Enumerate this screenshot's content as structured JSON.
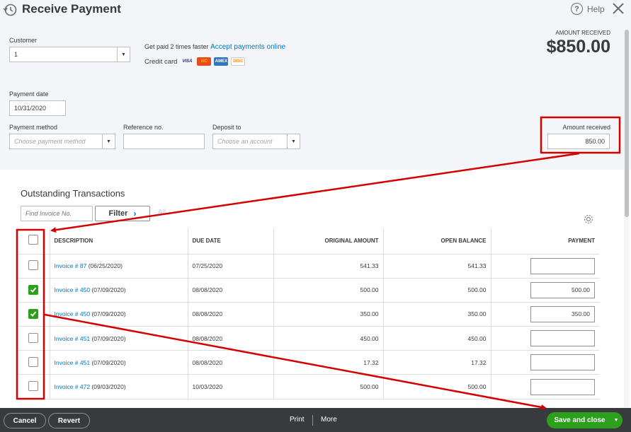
{
  "title": "Receive Payment",
  "help_label": "Help",
  "customer": {
    "label": "Customer",
    "value": "1"
  },
  "get_paid": {
    "text": "Get paid 2 times faster",
    "link": "Accept payments online",
    "credit_card_label": "Credit card"
  },
  "cards": [
    "VISA",
    "MC",
    "AMEX",
    "DISC"
  ],
  "amount_received_header": {
    "label": "AMOUNT RECEIVED",
    "value": "$850.00"
  },
  "payment_date": {
    "label": "Payment date",
    "value": "10/31/2020"
  },
  "payment_method": {
    "label": "Payment method",
    "placeholder": "Choose payment method"
  },
  "reference": {
    "label": "Reference no.",
    "value": ""
  },
  "deposit_to": {
    "label": "Deposit to",
    "placeholder": "Choose an account"
  },
  "amount_received_field": {
    "label": "Amount received",
    "value": "850.00"
  },
  "outstanding": {
    "title": "Outstanding Transactions",
    "find_placeholder": "Find Invoice No.",
    "filter_label": "Filter",
    "all_label": "All",
    "columns": [
      "DESCRIPTION",
      "DUE DATE",
      "ORIGINAL AMOUNT",
      "OPEN BALANCE",
      "PAYMENT"
    ],
    "rows": [
      {
        "checked": false,
        "invoice": "Invoice # 87",
        "date": "(06/25/2020)",
        "due": "07/25/2020",
        "original": "541.33",
        "open": "541.33",
        "payment": ""
      },
      {
        "checked": true,
        "invoice": "Invoice # 450",
        "date": "(07/09/2020)",
        "due": "08/08/2020",
        "original": "500.00",
        "open": "500.00",
        "payment": "500.00"
      },
      {
        "checked": true,
        "invoice": "Invoice # 450",
        "date": "(07/09/2020)",
        "due": "08/08/2020",
        "original": "350.00",
        "open": "350.00",
        "payment": "350.00"
      },
      {
        "checked": false,
        "invoice": "Invoice # 451",
        "date": "(07/09/2020)",
        "due": "08/08/2020",
        "original": "450.00",
        "open": "450.00",
        "payment": ""
      },
      {
        "checked": false,
        "invoice": "Invoice # 451",
        "date": "(07/09/2020)",
        "due": "08/08/2020",
        "original": "17.32",
        "open": "17.32",
        "payment": ""
      },
      {
        "checked": false,
        "invoice": "Invoice # 472",
        "date": "(09/03/2020)",
        "due": "10/03/2020",
        "original": "500.00",
        "open": "500.00",
        "payment": ""
      }
    ]
  },
  "footer": {
    "cancel": "Cancel",
    "revert": "Revert",
    "print": "Print",
    "more": "More",
    "save_close": "Save and close"
  },
  "colors": {
    "accent_green": "#2ca01c",
    "link_blue": "#0077c5",
    "annotation_red": "#d40000",
    "footer_bg": "#393a3d"
  }
}
